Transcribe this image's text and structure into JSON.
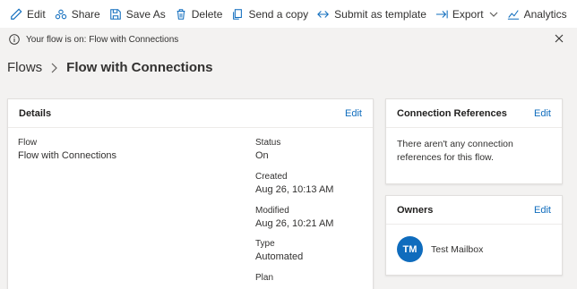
{
  "toolbar": {
    "edit": "Edit",
    "share": "Share",
    "save_as": "Save As",
    "delete": "Delete",
    "send_copy": "Send a copy",
    "submit_template": "Submit as template",
    "export": "Export",
    "analytics": "Analytics",
    "more": "···",
    "icons": [
      "edit-icon",
      "share-icon",
      "save-as-icon",
      "delete-icon",
      "copy-icon",
      "submit-icon",
      "export-icon",
      "analytics-icon"
    ]
  },
  "infobar": {
    "message": "Your flow is on: Flow with Connections"
  },
  "breadcrumb": {
    "root": "Flows",
    "current": "Flow with Connections"
  },
  "details": {
    "title": "Details",
    "edit": "Edit",
    "flow_label": "Flow",
    "flow_value": "Flow with Connections",
    "status_label": "Status",
    "status_value": "On",
    "created_label": "Created",
    "created_value": "Aug 26, 10:13 AM",
    "modified_label": "Modified",
    "modified_value": "Aug 26, 10:21 AM",
    "type_label": "Type",
    "type_value": "Automated",
    "plan_label": "Plan"
  },
  "connection_references": {
    "title": "Connection References",
    "edit": "Edit",
    "message": "There aren't any connection references for this flow."
  },
  "owners": {
    "title": "Owners",
    "edit": "Edit",
    "owner_initials": "TM",
    "owner_name": "Test Mailbox"
  },
  "colors": {
    "accent": "#0f6cbd",
    "background": "#f3f2f1",
    "card": "#ffffff",
    "text": "#323130"
  }
}
